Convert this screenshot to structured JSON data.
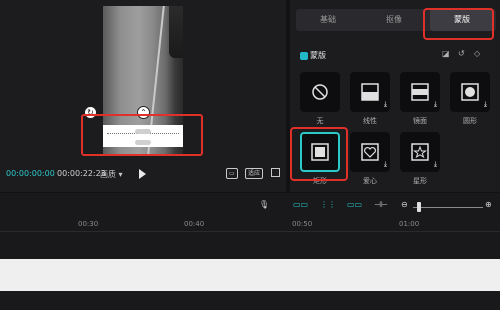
{
  "preview": {
    "current_time": "00:00:00:00",
    "total_time": "00:00:22:23",
    "quality_label": "画质 ▾",
    "fit_label": "适应",
    "ratio_icon": "ratio-icon"
  },
  "right_panel": {
    "tabs": [
      "基础",
      "抠像",
      "蒙版"
    ],
    "active_tab": "蒙版",
    "section_title": "蒙版",
    "masks": [
      {
        "label": "无",
        "icon": "no-mask-icon"
      },
      {
        "label": "线性",
        "icon": "linear-mask-icon"
      },
      {
        "label": "镜面",
        "icon": "mirror-mask-icon"
      },
      {
        "label": "圆形",
        "icon": "circle-mask-icon"
      },
      {
        "label": "矩形",
        "icon": "rect-mask-icon"
      },
      {
        "label": "爱心",
        "icon": "heart-mask-icon"
      },
      {
        "label": "星形",
        "icon": "star-mask-icon"
      }
    ],
    "selected_mask": "矩形"
  },
  "timeline": {
    "ruler": [
      "00:30",
      "00:40",
      "00:50",
      "01:00"
    ]
  },
  "colors": {
    "accent": "#2cc9c9",
    "highlight": "#e0302a"
  }
}
